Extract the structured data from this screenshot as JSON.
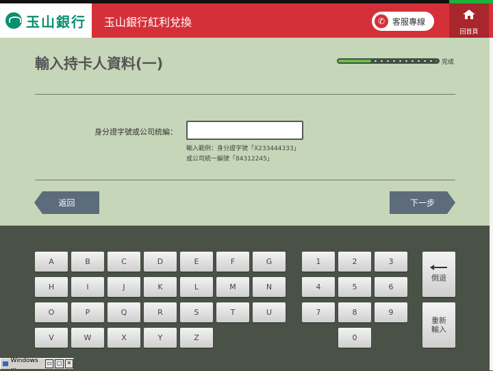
{
  "header": {
    "logo_text": "玉山銀行",
    "app_title": "玉山銀行紅利兌換",
    "service_label": "客服專線",
    "home_label": "回首頁"
  },
  "page": {
    "title": "輸入持卡人資料(一)",
    "progress_label": "完成",
    "progress_fraction": 0.33,
    "id_label": "身分證字號或公司統編：",
    "id_value": "",
    "hint_line1": "輸入範例：身分證字號「X233444333」",
    "hint_line2": "或公司統一編號「84312245」",
    "back_label": "返回",
    "next_label": "下一步"
  },
  "keyboard": {
    "letter_rows": [
      [
        "A",
        "B",
        "C",
        "D",
        "E",
        "F",
        "G"
      ],
      [
        "H",
        "I",
        "J",
        "K",
        "L",
        "M",
        "N"
      ],
      [
        "O",
        "P",
        "Q",
        "R",
        "S",
        "T",
        "U"
      ],
      [
        "V",
        "W",
        "X",
        "Y",
        "Z"
      ]
    ],
    "digit_rows": [
      [
        "1",
        "2",
        "3"
      ],
      [
        "4",
        "5",
        "6"
      ],
      [
        "7",
        "8",
        "9"
      ],
      [
        "",
        "0",
        ""
      ]
    ],
    "backspace_label": "倒退",
    "reset_label_line1": "重新",
    "reset_label_line2": "輸入"
  },
  "taskbar": {
    "item_label": "Windows ..."
  },
  "colors": {
    "brand_red": "#d5303a",
    "brand_green": "#0a8f72",
    "content_bg": "#c6d6b8",
    "keyboard_bg": "#4a5247"
  }
}
